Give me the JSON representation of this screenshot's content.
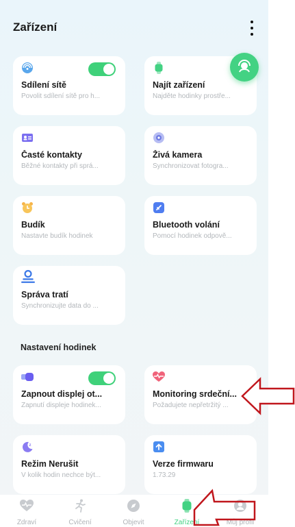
{
  "header": {
    "title": "Zařízení"
  },
  "cards": [
    {
      "name": "Sdílení sítě",
      "desc": "Povolit sdílení sítě pro h...",
      "icon": "network-share-icon",
      "toggle": true
    },
    {
      "name": "Najít zařízení",
      "desc": "Najděte hodinky prostře...",
      "icon": "watch-icon"
    },
    {
      "name": "Časté kontakty",
      "desc": "Běžné kontakty při sprá...",
      "icon": "contact-card-icon"
    },
    {
      "name": "Živá kamera",
      "desc": "Synchronizovat fotogra...",
      "icon": "camera-icon"
    },
    {
      "name": "Budík",
      "desc": "Nastavte budík hodinek",
      "icon": "alarm-clock-icon"
    },
    {
      "name": "Bluetooth volání",
      "desc": "Pomocí hodinek odpově...",
      "icon": "bluetooth-call-icon"
    },
    {
      "name": "Správa tratí",
      "desc": "Synchronizujte data do ...",
      "icon": "route-icon"
    }
  ],
  "section_title": "Nastavení hodinek",
  "settings_cards": [
    {
      "name": "Zapnout displej ot...",
      "desc": "Zapnutí displeje hodinek...",
      "icon": "raise-wrist-icon",
      "toggle": true
    },
    {
      "name": "Monitoring srdeční...",
      "desc": "Požadujete nepřetržitý ...",
      "icon": "heart-rate-icon"
    },
    {
      "name": "Režim Nerušit",
      "desc": "V kolik hodin nechce být...",
      "icon": "do-not-disturb-moon-icon"
    },
    {
      "name": "Verze firmwaru",
      "desc": "1.73.29",
      "icon": "firmware-upload-icon"
    }
  ],
  "tabs": [
    {
      "label": "Zdraví",
      "icon": "heart-icon"
    },
    {
      "label": "Cvičení",
      "icon": "running-icon"
    },
    {
      "label": "Objevit",
      "icon": "compass-icon"
    },
    {
      "label": "Zařízení",
      "icon": "watch-tab-icon",
      "active": true
    },
    {
      "label": "Můj profil",
      "icon": "profile-icon"
    }
  ],
  "colors": {
    "accent": "#43d283",
    "annotation": "#c0161c"
  }
}
